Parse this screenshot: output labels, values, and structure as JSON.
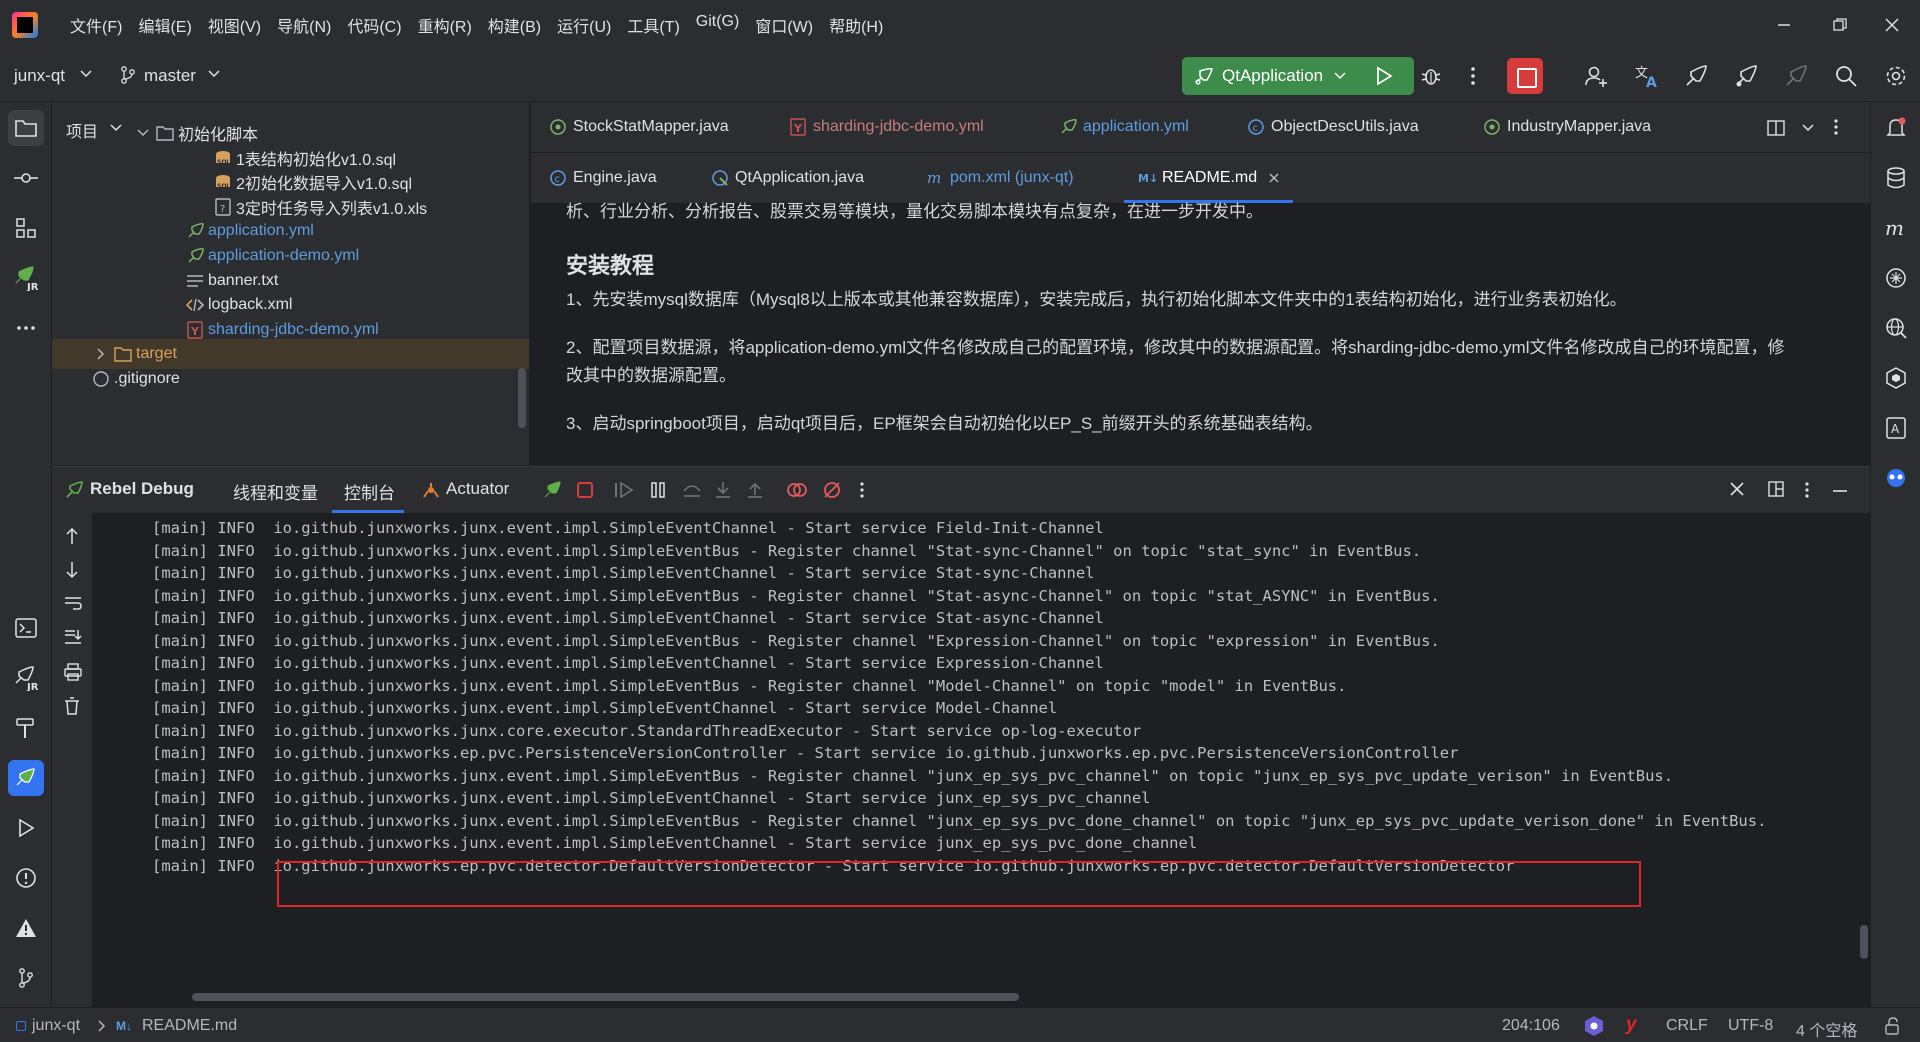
{
  "menu": [
    "文件(F)",
    "编辑(E)",
    "视图(V)",
    "导航(N)",
    "代码(C)",
    "重构(R)",
    "构建(B)",
    "运行(U)",
    "工具(T)",
    "Git(G)",
    "窗口(W)",
    "帮助(H)"
  ],
  "toolbar": {
    "project_name": "junx-qt",
    "branch": "master",
    "run_config": "QtApplication"
  },
  "project_panel": {
    "title": "项目",
    "tree": [
      {
        "label": "初始化脚本",
        "type": "folder",
        "indent": 1,
        "expanded": true
      },
      {
        "label": "1表结构初始化v1.0.sql",
        "type": "sql",
        "indent": 2
      },
      {
        "label": "2初始化数据导入v1.0.sql",
        "type": "sql",
        "indent": 2
      },
      {
        "label": "3定时任务导入列表v1.0.xls",
        "type": "xls",
        "indent": 2
      },
      {
        "label": "application.yml",
        "type": "yml",
        "indent": 1
      },
      {
        "label": "application-demo.yml",
        "type": "yml",
        "indent": 1
      },
      {
        "label": "banner.txt",
        "type": "txt",
        "indent": 1
      },
      {
        "label": "logback.xml",
        "type": "xml",
        "indent": 1
      },
      {
        "label": "sharding-jdbc-demo.yml",
        "type": "yaml-red",
        "indent": 1
      },
      {
        "label": "target",
        "type": "folder-orange",
        "indent": 0
      },
      {
        "label": ".gitignore",
        "type": "git",
        "indent": 0
      }
    ]
  },
  "editor": {
    "tabs_row1": [
      {
        "label": "StockStatMapper.java",
        "color": "#dfe1e5"
      },
      {
        "label": "sharding-jdbc-demo.yml",
        "color": "#c77d7d"
      },
      {
        "label": "application.yml",
        "color": "#5e9ce0"
      },
      {
        "label": "ObjectDescUtils.java",
        "color": "#dfe1e5"
      },
      {
        "label": "IndustryMapper.java",
        "color": "#dfe1e5"
      }
    ],
    "tabs_row2": [
      {
        "label": "Engine.java",
        "color": "#dfe1e5"
      },
      {
        "label": "QtApplication.java",
        "color": "#dfe1e5"
      },
      {
        "label": "pom.xml (junx-qt)",
        "color": "#5e9ce0"
      },
      {
        "label": "README.md",
        "color": "#ffffff",
        "active": true
      }
    ],
    "content": {
      "line0": "析、行业分析、分析报告、股票交易等模块，量化交易脚本模块有点复杂，在进一步开发中。",
      "heading": "安装教程",
      "p1": "1、先安装mysql数据库（Mysql8以上版本或其他兼容数据库），安装完成后，执行初始化脚本文件夹中的1表结构初始化，进行业务表初始化。",
      "p2a": "2、配置项目数据源，将application-demo.yml文件名修改成自己的配置环境，修改其中的数据源配置。将sharding-jdbc-demo.yml文件名修改成自己的环境配置，修",
      "p2b": "改其中的数据源配置。",
      "p3": "3、启动springboot项目，启动qt项目后，EP框架会自动初始化以EP_S_前缀开头的系统基础表结构。"
    }
  },
  "debug": {
    "title": "Rebel Debug",
    "tabs": [
      "线程和变量",
      "控制台",
      "Actuator"
    ],
    "active_tab": "控制台",
    "log": [
      "[main] INFO  io.github.junxworks.junx.event.impl.SimpleEventChannel - Start service Field-Init-Channel",
      "[main] INFO  io.github.junxworks.junx.event.impl.SimpleEventBus - Register channel \"Stat-sync-Channel\" on topic \"stat_sync\" in EventBus.",
      "[main] INFO  io.github.junxworks.junx.event.impl.SimpleEventChannel - Start service Stat-sync-Channel",
      "[main] INFO  io.github.junxworks.junx.event.impl.SimpleEventBus - Register channel \"Stat-async-Channel\" on topic \"stat_ASYNC\" in EventBus.",
      "[main] INFO  io.github.junxworks.junx.event.impl.SimpleEventChannel - Start service Stat-async-Channel",
      "[main] INFO  io.github.junxworks.junx.event.impl.SimpleEventBus - Register channel \"Expression-Channel\" on topic \"expression\" in EventBus.",
      "[main] INFO  io.github.junxworks.junx.event.impl.SimpleEventChannel - Start service Expression-Channel",
      "[main] INFO  io.github.junxworks.junx.event.impl.SimpleEventBus - Register channel \"Model-Channel\" on topic \"model\" in EventBus.",
      "[main] INFO  io.github.junxworks.junx.event.impl.SimpleEventChannel - Start service Model-Channel",
      "[main] INFO  io.github.junxworks.junx.core.executor.StandardThreadExecutor - Start service op-log-executor",
      "[main] INFO  io.github.junxworks.ep.pvc.PersistenceVersionController - Start service io.github.junxworks.ep.pvc.PersistenceVersionController",
      "[main] INFO  io.github.junxworks.junx.event.impl.SimpleEventBus - Register channel \"junx_ep_sys_pvc_channel\" on topic \"junx_ep_sys_pvc_update_verison\" in EventBus.",
      "[main] INFO  io.github.junxworks.junx.event.impl.SimpleEventChannel - Start service junx_ep_sys_pvc_channel",
      "[main] INFO  io.github.junxworks.junx.event.impl.SimpleEventBus - Register channel \"junx_ep_sys_pvc_done_channel\" on topic \"junx_ep_sys_pvc_update_verison_done\" in EventBus.",
      "[main] INFO  io.github.junxworks.junx.event.impl.SimpleEventChannel - Start service junx_ep_sys_pvc_done_channel",
      "[main] INFO  io.github.junxworks.ep.pvc.detector.DefaultVersionDetector - Start service io.github.junxworks.ep.pvc.detector.DefaultVersionDetector"
    ]
  },
  "statusbar": {
    "project": "junx-qt",
    "file": "README.md",
    "position": "204:106",
    "line_sep": "CRLF",
    "encoding": "UTF-8",
    "indent": "4 个空格"
  },
  "colors": {
    "accent_green": "#3d8c4c",
    "stop_red": "#d63c3c",
    "highlight_red": "#e0252a"
  }
}
